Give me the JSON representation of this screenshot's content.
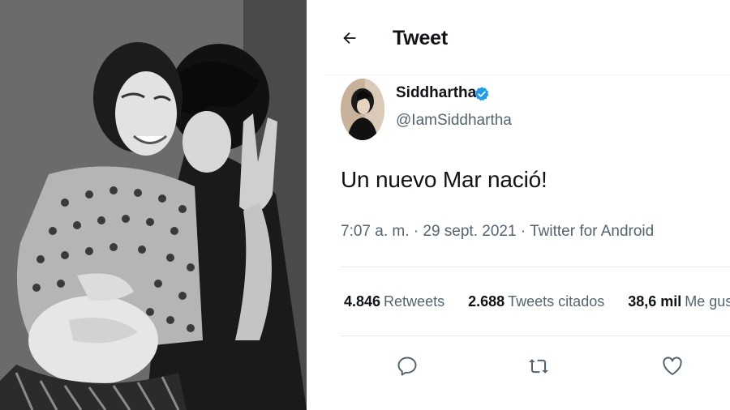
{
  "photo": {
    "description_icon": "couple-photo"
  },
  "header": {
    "title": "Tweet",
    "back_icon": "arrow-left-icon"
  },
  "author": {
    "name": "Siddhartha",
    "handle": "@IamSiddhartha",
    "verified": true
  },
  "tweet": {
    "text": "Un nuevo Mar nació!"
  },
  "meta": {
    "time": "7:07 a. m.",
    "sep1": "·",
    "date": "29 sept. 2021",
    "sep2": "·",
    "source": "Twitter for Android"
  },
  "stats": [
    {
      "count": "4.846",
      "label": "Retweets"
    },
    {
      "count": "2.688",
      "label": "Tweets citados"
    },
    {
      "count": "38,6 mil",
      "label": "Me gusta"
    }
  ],
  "actions": [
    "reply-icon",
    "retweet-icon",
    "like-icon"
  ],
  "colors": {
    "text": "#0f1419",
    "secondary": "#536471",
    "verified": "#1d9bf0",
    "rule": "#e6ecf0"
  }
}
